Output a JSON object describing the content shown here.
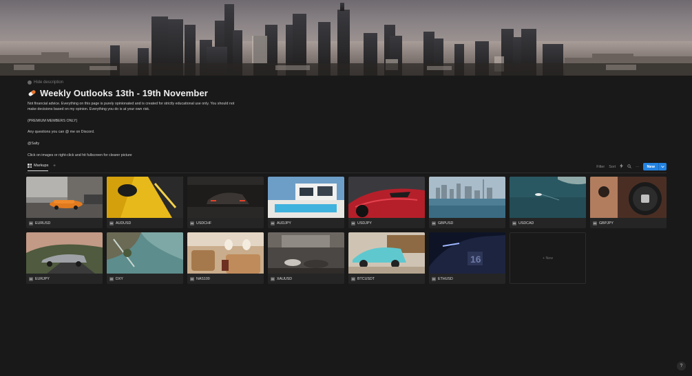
{
  "page": {
    "hide_description": "Hide description",
    "title": "Weekly Outlooks 13th -  19th November",
    "description": [
      "Not financial advice. Everything on this page is purely opinionated and is created for strictly educational use only. You should not make decisions based on my opinion. Everything you do is at your own risk.",
      "",
      "(PREMIUM MEMBERS ONLY)",
      "",
      "Any questions you can @ me on Discord.",
      "",
      "@Salty",
      "",
      "Click on images or right-click and hit fullscreen for clearer picture"
    ]
  },
  "view": {
    "tab_label": "Markups",
    "add_view": "+",
    "filter": "Filter",
    "sort": "Sort",
    "more": "···",
    "new_label": "New"
  },
  "gallery": {
    "cards": [
      {
        "label": "EURUSD",
        "scene": "orange-car-street"
      },
      {
        "label": "AUDUSD",
        "scene": "yellow-car-closeup"
      },
      {
        "label": "USDCHF",
        "scene": "dark-car-night"
      },
      {
        "label": "AUDJPY",
        "scene": "modern-villa-pool"
      },
      {
        "label": "USDJPY",
        "scene": "red-supercar"
      },
      {
        "label": "GBPUSD",
        "scene": "city-skyline-water"
      },
      {
        "label": "USDCAD",
        "scene": "aerial-ocean-yacht"
      },
      {
        "label": "GBPJPY",
        "scene": "car-interior-wheel"
      },
      {
        "label": "EURJPY",
        "scene": "grey-car-road"
      },
      {
        "label": "DXY",
        "scene": "aerial-coastline"
      },
      {
        "label": "NAS100",
        "scene": "private-jet-cabin"
      },
      {
        "label": "XAUUSD",
        "scene": "luxury-living-room"
      },
      {
        "label": "BTCUSDT",
        "scene": "teal-porsche"
      },
      {
        "label": "ETHUSD",
        "scene": "dark-hypercar"
      }
    ],
    "new_card": "+ New"
  },
  "help": "?"
}
